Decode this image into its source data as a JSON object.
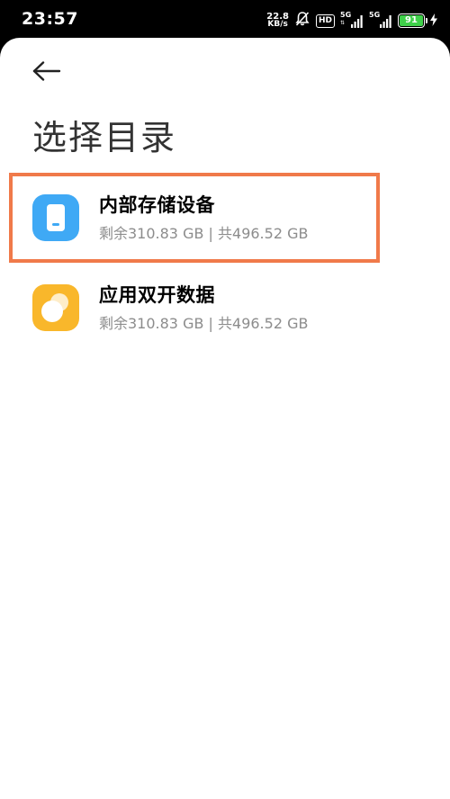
{
  "status_bar": {
    "time": "23:57",
    "net_speed_value": "22.8",
    "net_speed_unit": "KB/s",
    "hd_label": "HD",
    "sim1_label": "5G",
    "sim2_label": "5G",
    "battery_level": "91",
    "battery_color": "#3fd14a"
  },
  "page": {
    "title": "选择目录"
  },
  "storage_items": [
    {
      "title": "内部存储设备",
      "subtitle": "剩余310.83 GB | 共496.52 GB",
      "icon": "phone-storage-icon",
      "icon_color": "#3fa9f5"
    },
    {
      "title": "应用双开数据",
      "subtitle": "剩余310.83 GB | 共496.52 GB",
      "icon": "dual-apps-icon",
      "icon_color": "#f9b72b"
    }
  ],
  "colors": {
    "highlight": "#f07a4a",
    "title_text": "#333333",
    "subtitle_text": "#8c8c8c"
  }
}
